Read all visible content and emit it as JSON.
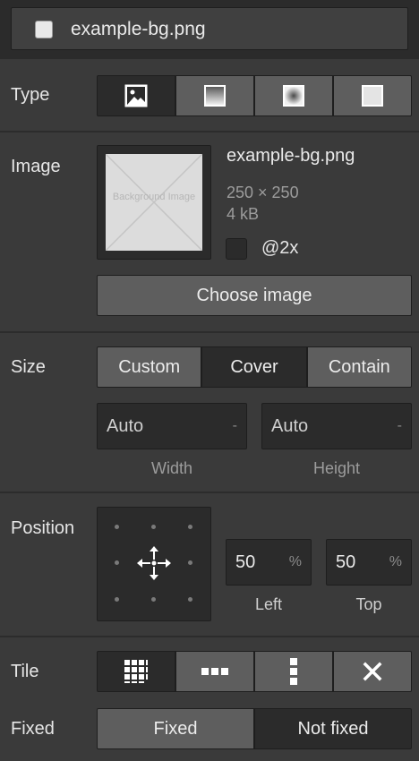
{
  "header": {
    "title": "example-bg.png"
  },
  "type": {
    "label": "Type",
    "options": [
      "image-icon",
      "linear-gradient-icon",
      "radial-gradient-icon",
      "solid-color-icon"
    ],
    "active": 0
  },
  "image": {
    "label": "Image",
    "filename": "example-bg.png",
    "dimensions": "250 × 250",
    "filesize": "4 kB",
    "retina_label": "@2x",
    "placeholder_text": "Background Image",
    "choose_label": "Choose image"
  },
  "size": {
    "label": "Size",
    "options": [
      "Custom",
      "Cover",
      "Contain"
    ],
    "active": "Cover",
    "width": {
      "value": "Auto",
      "unit": "-",
      "label": "Width"
    },
    "height": {
      "value": "Auto",
      "unit": "-",
      "label": "Height"
    }
  },
  "position": {
    "label": "Position",
    "left": {
      "value": "50",
      "unit": "%",
      "label": "Left"
    },
    "top": {
      "value": "50",
      "unit": "%",
      "label": "Top"
    }
  },
  "tile": {
    "label": "Tile",
    "options": [
      "tile-both-icon",
      "tile-horizontal-icon",
      "tile-vertical-icon",
      "no-tile-icon"
    ],
    "active": 0
  },
  "fixed": {
    "label": "Fixed",
    "options": [
      "Fixed",
      "Not fixed"
    ],
    "active": "Not fixed"
  },
  "colors": {
    "panel_bg": "#3a3a3a",
    "active_bg": "#2b2b2b",
    "button_bg": "#5e5e5e"
  }
}
